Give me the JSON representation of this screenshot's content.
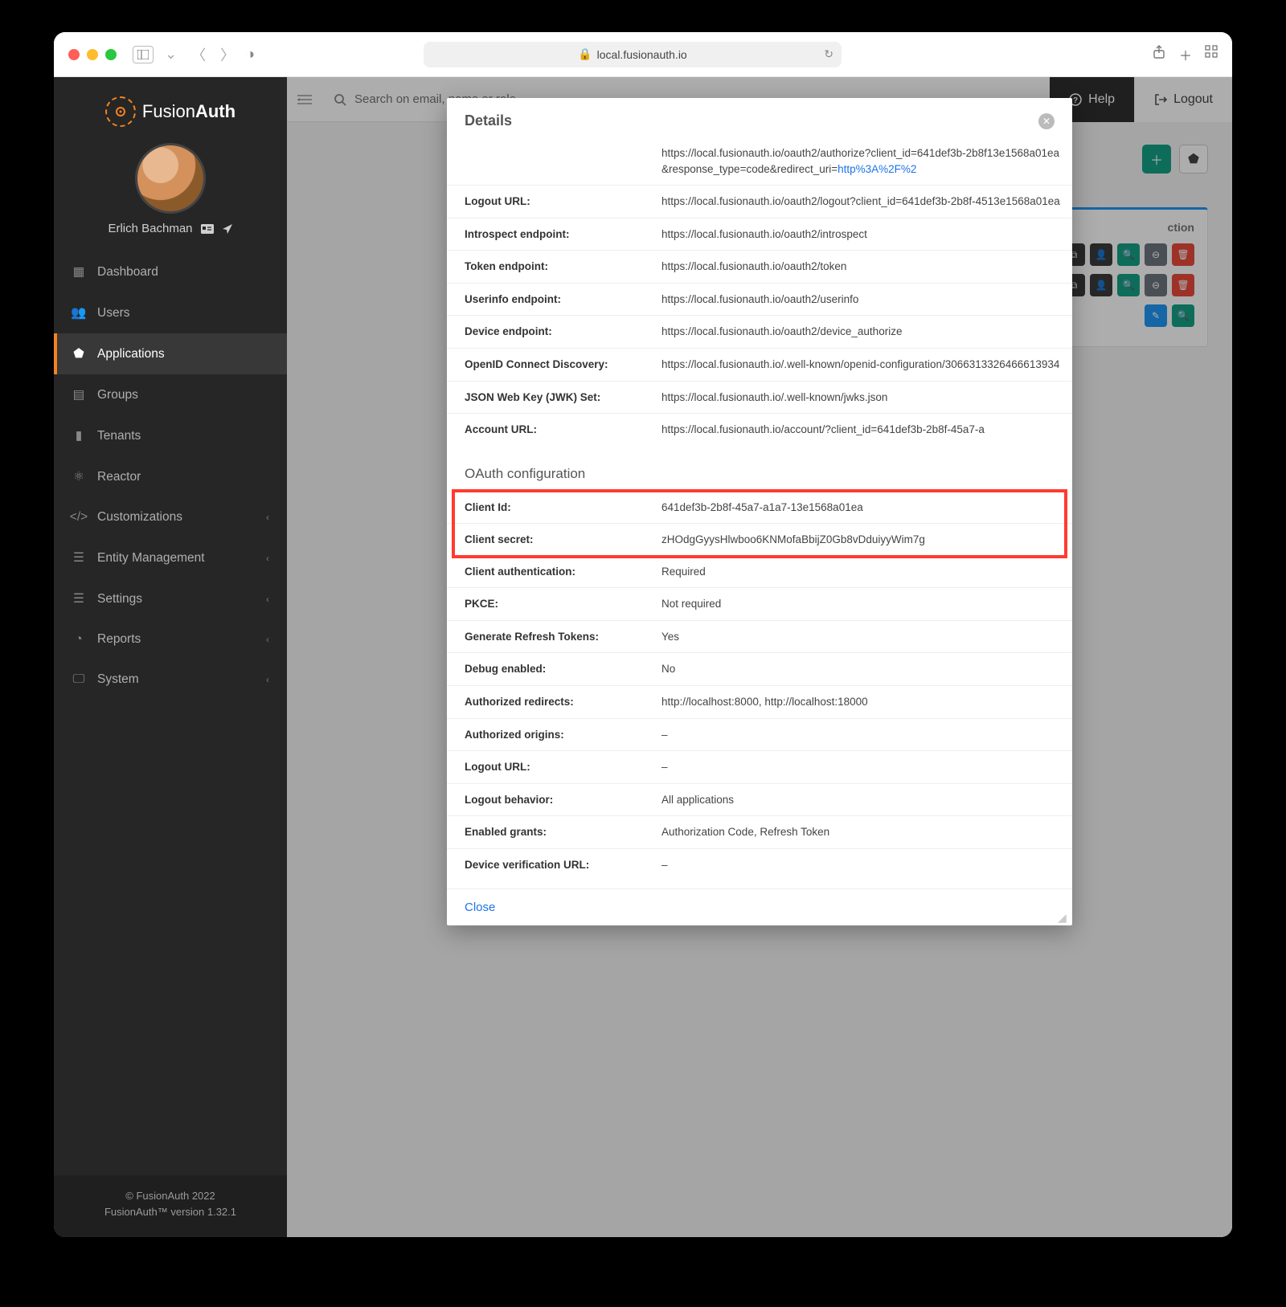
{
  "browser": {
    "address": "local.fusionauth.io",
    "lock": "🔒"
  },
  "brand": {
    "name_pre": "Fusion",
    "name_bold": "Auth"
  },
  "user": {
    "name": "Erlich Bachman"
  },
  "sidebar": {
    "items": [
      {
        "label": "Dashboard",
        "icon": "dashboard"
      },
      {
        "label": "Users",
        "icon": "users"
      },
      {
        "label": "Applications",
        "icon": "cube",
        "active": true
      },
      {
        "label": "Groups",
        "icon": "groups"
      },
      {
        "label": "Tenants",
        "icon": "building"
      },
      {
        "label": "Reactor",
        "icon": "atom"
      },
      {
        "label": "Customizations",
        "icon": "code",
        "caret": true
      },
      {
        "label": "Entity Management",
        "icon": "list",
        "caret": true
      },
      {
        "label": "Settings",
        "icon": "sliders",
        "caret": true
      },
      {
        "label": "Reports",
        "icon": "pie",
        "caret": true
      },
      {
        "label": "System",
        "icon": "monitor",
        "caret": true
      }
    ]
  },
  "topbar": {
    "search_placeholder": "Search on email, name or role",
    "help": "Help",
    "logout": "Logout"
  },
  "background_card": {
    "title_fragment": "ction"
  },
  "footer": {
    "copyright": "© FusionAuth 2022",
    "version": "FusionAuth™ version 1.32.1"
  },
  "modal": {
    "title": "Details",
    "close_label": "Close",
    "top_rows": [
      {
        "key": "",
        "val_plain": "https://local.fusionauth.io/oauth2/authorize?client_id=641def3b-2b8f13e1568a01ea&response_type=code&redirect_uri=",
        "val_link": "http%3A%2F%2"
      },
      {
        "key": "Logout URL:",
        "val": "https://local.fusionauth.io/oauth2/logout?client_id=641def3b-2b8f-4513e1568a01ea"
      },
      {
        "key": "Introspect endpoint:",
        "val": "https://local.fusionauth.io/oauth2/introspect"
      },
      {
        "key": "Token endpoint:",
        "val": "https://local.fusionauth.io/oauth2/token"
      },
      {
        "key": "Userinfo endpoint:",
        "val": "https://local.fusionauth.io/oauth2/userinfo"
      },
      {
        "key": "Device endpoint:",
        "val": "https://local.fusionauth.io/oauth2/device_authorize"
      },
      {
        "key": "OpenID Connect Discovery:",
        "val": "https://local.fusionauth.io/.well-known/openid-configuration/3066313326466613934"
      },
      {
        "key": "JSON Web Key (JWK) Set:",
        "val": "https://local.fusionauth.io/.well-known/jwks.json"
      },
      {
        "key": "Account URL:",
        "val": "https://local.fusionauth.io/account/?client_id=641def3b-2b8f-45a7-a"
      }
    ],
    "oauth_title": "OAuth configuration",
    "highlight": [
      {
        "key": "Client Id:",
        "val": "641def3b-2b8f-45a7-a1a7-13e1568a01ea"
      },
      {
        "key": "Client secret:",
        "val": "zHOdgGyysHlwboo6KNMofaBbijZ0Gb8vDduiyyWim7g"
      }
    ],
    "oauth_rows": [
      {
        "key": "Client authentication:",
        "val": "Required"
      },
      {
        "key": "PKCE:",
        "val": "Not required"
      },
      {
        "key": "Generate Refresh Tokens:",
        "val": "Yes"
      },
      {
        "key": "Debug enabled:",
        "val": "No"
      },
      {
        "key": "Authorized redirects:",
        "val": "http://localhost:8000, http://localhost:18000"
      },
      {
        "key": "Authorized origins:",
        "val": "–"
      },
      {
        "key": "Logout URL:",
        "val": "–"
      },
      {
        "key": "Logout behavior:",
        "val": "All applications"
      },
      {
        "key": "Enabled grants:",
        "val": "Authorization Code, Refresh Token"
      },
      {
        "key": "Device verification URL:",
        "val": "–"
      }
    ]
  }
}
